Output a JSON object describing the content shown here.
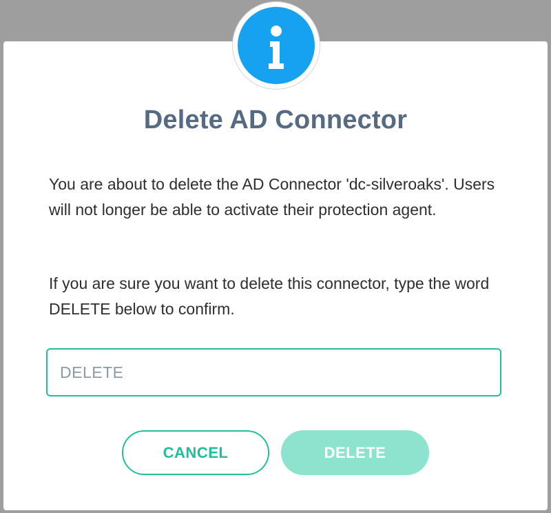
{
  "colors": {
    "accent": "#1fbf9a",
    "accent_light": "#8ee3cf",
    "info_blue": "#16a2f1",
    "title_color": "#566a83",
    "text": "#2e2e2e",
    "backdrop": "#9e9e9e"
  },
  "dialog": {
    "icon": "info-icon",
    "title": "Delete AD Connector",
    "message": "You are about to delete the AD Connector 'dc-silveroaks'. Users will not longer be able to activate their protection agent.",
    "instruction": "If you are sure you want to delete this connector, type the word DELETE below to confirm.",
    "input": {
      "value": "",
      "placeholder": "DELETE"
    },
    "cancel_label": "CANCEL",
    "delete_label": "DELETE",
    "delete_disabled": true
  }
}
